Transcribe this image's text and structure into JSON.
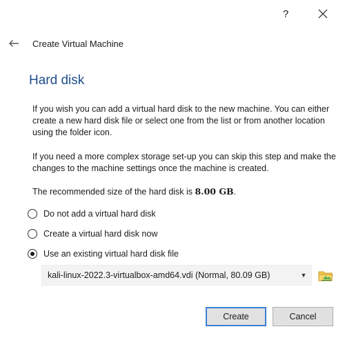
{
  "title_bar": {
    "help_label": "?",
    "close_label": "✕"
  },
  "wizard": {
    "title": "Create Virtual Machine"
  },
  "page": {
    "heading": "Hard disk",
    "paragraph_1": "If you wish you can add a virtual hard disk to the new machine. You can either create a new hard disk file or select one from the list or from another location using the folder icon.",
    "paragraph_2": "If you need a more complex storage set-up you can skip this step and make the changes to the machine settings once the machine is created.",
    "recommended_prefix": "The recommended size of the hard disk is ",
    "recommended_size": "8.00 GB",
    "recommended_suffix": "."
  },
  "options": [
    {
      "label": "Do not add a virtual hard disk",
      "checked": false
    },
    {
      "label": "Create a virtual hard disk now",
      "checked": false
    },
    {
      "label": "Use an existing virtual hard disk file",
      "checked": true
    }
  ],
  "disk_select": {
    "selected": "kali-linux-2022.3-virtualbox-amd64.vdi (Normal, 80.09 GB)"
  },
  "buttons": {
    "create": "Create",
    "cancel": "Cancel"
  },
  "icons": {
    "help": "help-icon",
    "close": "close-icon",
    "back": "back-arrow-icon",
    "dropdown": "chevron-down-icon",
    "folder": "folder-icon"
  },
  "colors": {
    "heading": "#1f4e8c",
    "default_button_border": "#3c7fd4"
  }
}
